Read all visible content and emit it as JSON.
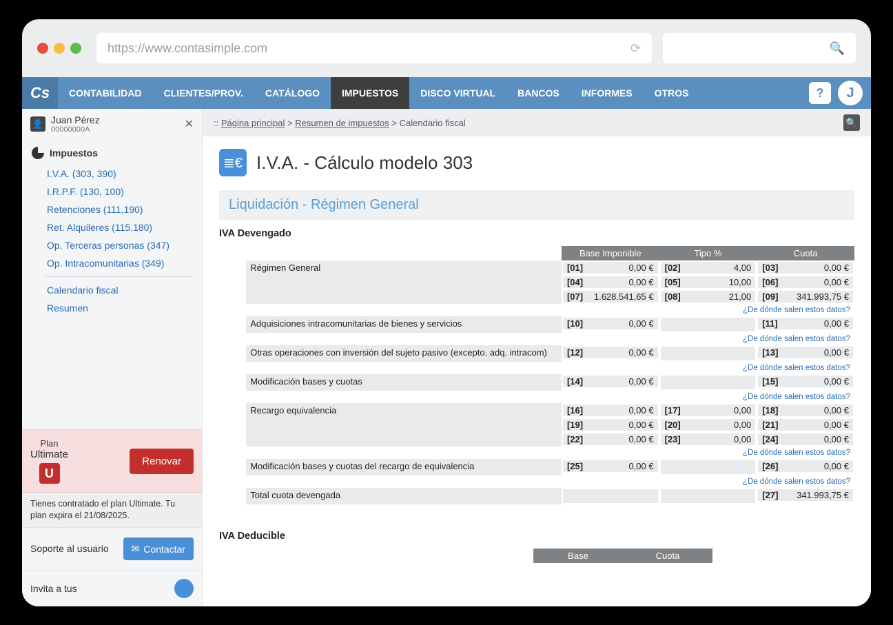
{
  "browser": {
    "url": "https://www.contasimple.com"
  },
  "nav": {
    "logo": "Cs",
    "items": [
      "CONTABILIDAD",
      "CLIENTES/PROV.",
      "CATÁLOGO",
      "IMPUESTOS",
      "DISCO VIRTUAL",
      "BANCOS",
      "INFORMES",
      "OTROS"
    ],
    "active_index": 3,
    "help_label": "?",
    "avatar_initial": "J"
  },
  "user": {
    "name": "Juan Pérez",
    "id": "00000000A"
  },
  "sidebar": {
    "section_title": "Impuestos",
    "links": [
      "I.V.A. (303, 390)",
      "I.R.P.F. (130, 100)",
      "Retenciones (111,190)",
      "Ret. Alquileres (115,180)",
      "Op. Terceras personas (347)",
      "Op. Intracomunitarias (349)"
    ],
    "links2": [
      "Calendario fiscal",
      "Resumen"
    ]
  },
  "plan": {
    "line1": "Plan",
    "line2": "Ultimate",
    "badge": "U",
    "button": "Renovar",
    "note": "Tienes contratado el plan Ultimate. Tu plan expira el 21/08/2025."
  },
  "support": {
    "label": "Soporte al usuario",
    "button": "Contactar"
  },
  "invite": {
    "label": "Invita a tus"
  },
  "breadcrumbs": {
    "prefix": ":: ",
    "a": "Página principal",
    "b": "Resumen de impuestos",
    "c": "Calendario fiscal"
  },
  "page": {
    "title": "I.V.A. - Cálculo modelo 303",
    "section": "Liquidación - Régimen General",
    "sub1": "IVA Devengado",
    "sub2": "IVA Deducible",
    "headers": {
      "base": "Base Imponible",
      "tipo": "Tipo %",
      "cuota": "Cuota",
      "base2": "Base",
      "cuota2": "Cuota"
    },
    "help": "¿De dónde salen estos datos?",
    "rows": [
      {
        "desc": "Régimen General",
        "cells": [
          [
            "[01]",
            "0,00 €",
            "[02]",
            "4,00",
            "[03]",
            "0,00 €"
          ],
          [
            "[04]",
            "0,00 €",
            "[05]",
            "10,00",
            "[06]",
            "0,00 €"
          ],
          [
            "[07]",
            "1.628.541,65 €",
            "[08]",
            "21,00",
            "[09]",
            "341.993,75 €"
          ]
        ],
        "help": true
      },
      {
        "desc": "Adquisiciones intracomunitarias de bienes y servicios",
        "cells": [
          [
            "[10]",
            "0,00 €",
            "",
            "",
            "[11]",
            "0,00 €"
          ]
        ],
        "help": true
      },
      {
        "desc": "Otras operaciones con inversión del sujeto pasivo (excepto. adq. intracom)",
        "cells": [
          [
            "[12]",
            "0,00 €",
            "",
            "",
            "[13]",
            "0,00 €"
          ]
        ],
        "help": true
      },
      {
        "desc": "Modificación bases y cuotas",
        "cells": [
          [
            "[14]",
            "0,00 €",
            "",
            "",
            "[15]",
            "0,00 €"
          ]
        ],
        "help": true
      },
      {
        "desc": "Recargo equivalencia",
        "cells": [
          [
            "[16]",
            "0,00 €",
            "[17]",
            "0,00",
            "[18]",
            "0,00 €"
          ],
          [
            "[19]",
            "0,00 €",
            "[20]",
            "0,00",
            "[21]",
            "0,00 €"
          ],
          [
            "[22]",
            "0,00 €",
            "[23]",
            "0,00",
            "[24]",
            "0,00 €"
          ]
        ],
        "help": true
      },
      {
        "desc": "Modificación bases y cuotas del recargo de equivalencia",
        "cells": [
          [
            "[25]",
            "0,00 €",
            "",
            "",
            "[26]",
            "0,00 €"
          ]
        ],
        "help": true
      },
      {
        "desc": "Total cuota devengada",
        "cells": [
          [
            "",
            "",
            "",
            "",
            "[27]",
            "341.993,75 €"
          ]
        ],
        "help": false,
        "total": true
      }
    ]
  }
}
